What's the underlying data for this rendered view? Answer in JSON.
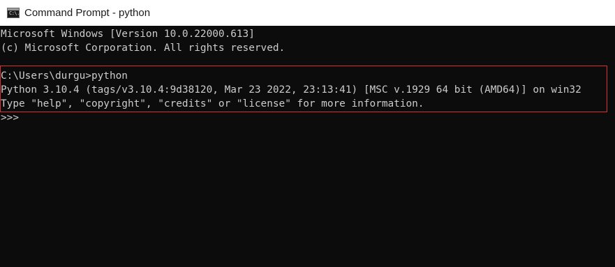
{
  "window": {
    "title": "Command Prompt - python",
    "icon": "cmd-icon",
    "icon_glyph": "C:\\."
  },
  "console": {
    "lines": [
      "Microsoft Windows [Version 10.0.22000.613]",
      "(c) Microsoft Corporation. All rights reserved.",
      "",
      "C:\\Users\\durgu>python",
      "Python 3.10.4 (tags/v3.10.4:9d38120, Mar 23 2022, 23:13:41) [MSC v.1929 64 bit (AMD64)] on win32",
      "Type \"help\", \"copyright\", \"credits\" or \"license\" for more information.",
      ">>> "
    ]
  },
  "colors": {
    "background": "#0c0c0c",
    "text": "#cccccc",
    "highlight_border": "#d9302f",
    "titlebar": "#ffffff"
  }
}
